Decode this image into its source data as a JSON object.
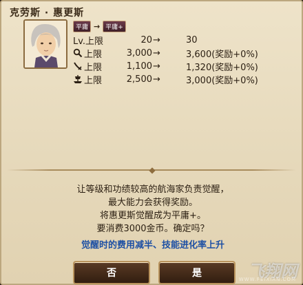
{
  "dialog": {
    "title": "克劳斯 · 惠更斯",
    "rank_from": "平庸",
    "rank_arrow": "→",
    "rank_to": "平庸+",
    "stats": [
      {
        "icon": "level-icon",
        "label": "Lv.上限",
        "current": "20",
        "arrow": "→",
        "next": "30"
      },
      {
        "icon": "magnifier-icon",
        "label": "上限",
        "current": "3,000",
        "arrow": "→",
        "next": "3,600(奖励+0%)"
      },
      {
        "icon": "sword-icon",
        "label": "上限",
        "current": "1,100",
        "arrow": "→",
        "next": "1,320(奖励+0%)"
      },
      {
        "icon": "ship-icon",
        "label": "上限",
        "current": "2,500",
        "arrow": "→",
        "next": "3,000(奖励+0%)"
      }
    ],
    "message_lines": [
      "让等级和功绩较高的航海家负责觉醒，",
      "最大能力会获得奖励。",
      "将惠更斯觉醒成为平庸+。",
      "要消费3000金币。确定吗？"
    ],
    "highlight": "觉醒时的费用减半、技能进化率上升",
    "no_label": "否",
    "yes_label": "是"
  },
  "watermark": {
    "text": "飞翔网",
    "url": "WWW.FEIXIAN.COM"
  }
}
